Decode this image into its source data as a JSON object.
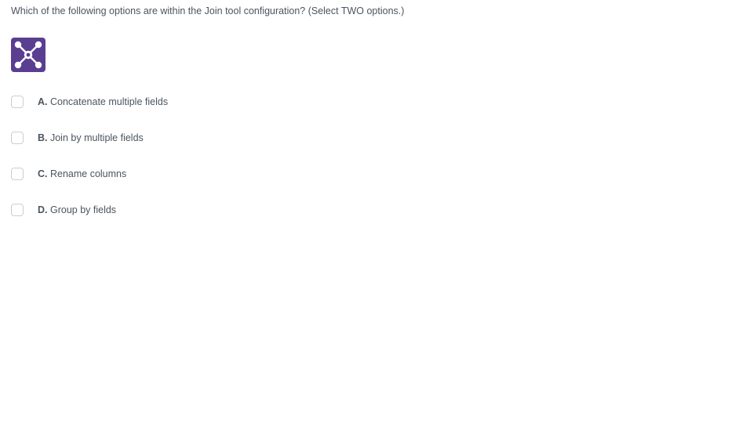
{
  "question": "Which of the following options are within the Join tool configuration? (Select TWO options.)",
  "icon": {
    "name": "join-tool-icon",
    "bg": "#5a3e92",
    "fg": "#ffffff"
  },
  "options": [
    {
      "letter": "A.",
      "text": "Concatenate multiple fields",
      "checked": false
    },
    {
      "letter": "B.",
      "text": "Join by multiple fields",
      "checked": false
    },
    {
      "letter": "C.",
      "text": "Rename columns",
      "checked": false
    },
    {
      "letter": "D.",
      "text": "Group by fields",
      "checked": false
    }
  ]
}
